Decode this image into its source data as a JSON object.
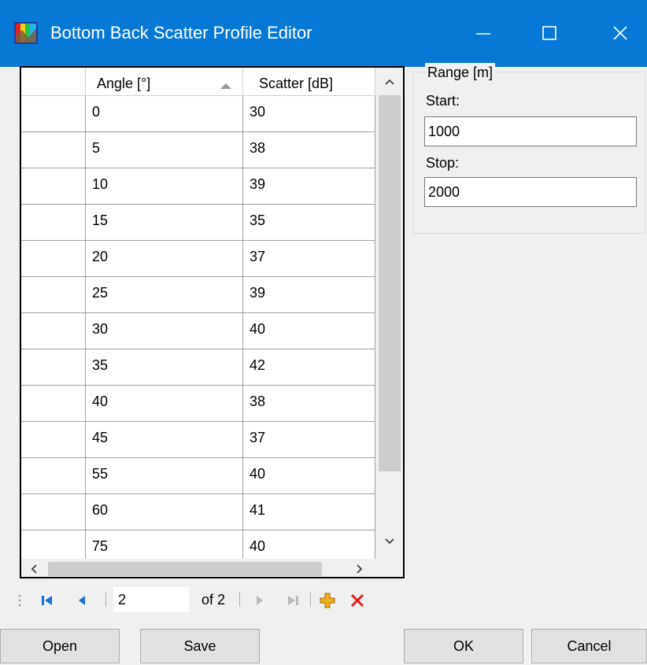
{
  "window": {
    "title": "Bottom Back Scatter Profile Editor",
    "icon": "app-color-icon",
    "colors": {
      "titlebar": "#0878d6",
      "accent_delete": "#e02020",
      "accent_add": "#f0b020",
      "nav_blue": "#1e6fd9"
    }
  },
  "grid": {
    "columns": [
      "Angle [°]",
      "Scatter [dB]"
    ],
    "sorted_column": "Angle [°]",
    "sort_direction": "ascending",
    "rows": [
      {
        "angle": "0",
        "scatter": "30"
      },
      {
        "angle": "5",
        "scatter": "38"
      },
      {
        "angle": "10",
        "scatter": "39"
      },
      {
        "angle": "15",
        "scatter": "35"
      },
      {
        "angle": "20",
        "scatter": "37"
      },
      {
        "angle": "25",
        "scatter": "39"
      },
      {
        "angle": "30",
        "scatter": "40"
      },
      {
        "angle": "35",
        "scatter": "42"
      },
      {
        "angle": "40",
        "scatter": "38"
      },
      {
        "angle": "45",
        "scatter": "37"
      },
      {
        "angle": "55",
        "scatter": "40"
      },
      {
        "angle": "60",
        "scatter": "41"
      },
      {
        "angle": "75",
        "scatter": "40"
      }
    ]
  },
  "range": {
    "legend": "Range [m]",
    "start_label": "Start:",
    "start_value": "1000",
    "stop_label": "Stop:",
    "stop_value": "2000"
  },
  "navigator": {
    "position": "2",
    "count_text": "of 2"
  },
  "buttons": {
    "open": "Open",
    "save": "Save",
    "ok": "OK",
    "cancel": "Cancel"
  }
}
